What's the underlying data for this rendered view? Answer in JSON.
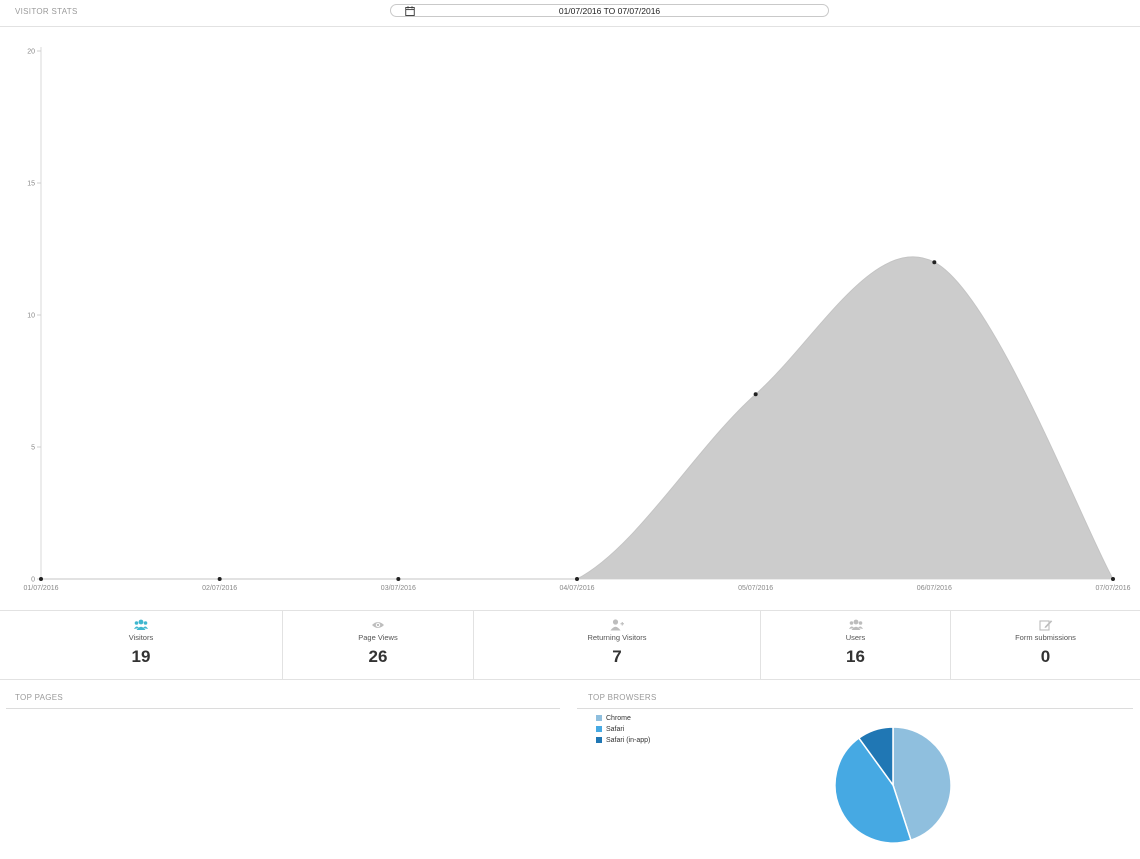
{
  "header": {
    "title": "VISITOR STATS",
    "date_range": "01/07/2016 TO 07/07/2016",
    "calendar_icon": "calendar-icon"
  },
  "chart_data": {
    "type": "area",
    "x": [
      "01/07/2016",
      "02/07/2016",
      "03/07/2016",
      "04/07/2016",
      "05/07/2016",
      "06/07/2016",
      "07/07/2016"
    ],
    "values": [
      0,
      0,
      0,
      0,
      7,
      12,
      0
    ],
    "yticks": [
      0,
      5,
      10,
      15,
      20
    ],
    "ylim": [
      0,
      20
    ],
    "fill_color": "#cccccc",
    "point_color": "#222222"
  },
  "stats": [
    {
      "label": "Visitors",
      "value": "19",
      "icon": "users-icon",
      "icon_color": "#3fb7cf"
    },
    {
      "label": "Page Views",
      "value": "26",
      "icon": "eye-icon",
      "icon_color": "#bdbdbd"
    },
    {
      "label": "Returning Visitors",
      "value": "7",
      "icon": "user-plus-icon",
      "icon_color": "#bdbdbd"
    },
    {
      "label": "Users",
      "value": "16",
      "icon": "users-icon",
      "icon_color": "#bdbdbd"
    },
    {
      "label": "Form submissions",
      "value": "0",
      "icon": "edit-icon",
      "icon_color": "#bdbdbd"
    }
  ],
  "top_pages": {
    "title": "TOP PAGES"
  },
  "top_browsers": {
    "title": "TOP BROWSERS",
    "chart_data": {
      "type": "pie",
      "categories": [
        "Chrome",
        "Safari",
        "Safari (in-app)"
      ],
      "values": [
        45,
        45,
        10
      ],
      "colors": [
        "#8fbfde",
        "#46a9e3",
        "#2077b4"
      ]
    }
  }
}
